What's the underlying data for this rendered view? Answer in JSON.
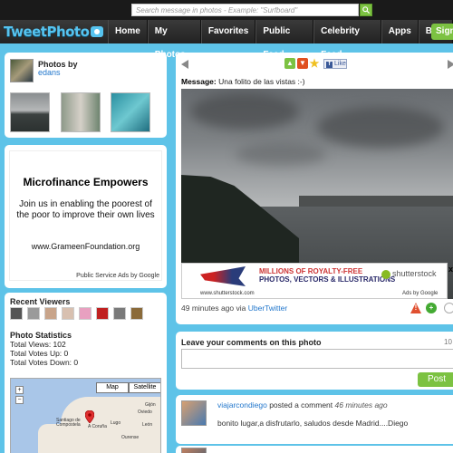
{
  "search": {
    "placeholder": "Search message in photos - Example: \"Surfboard\""
  },
  "header": {
    "logo": "TweetPhoto",
    "nav": [
      "Home",
      "My Photos",
      "Favorites",
      "Public Feed",
      "Celebrity Feed",
      "Apps",
      "Blog"
    ],
    "signup": "Sign"
  },
  "profile": {
    "photos_by_label": "Photos by",
    "username": "edans"
  },
  "ad": {
    "title": "Microfinance Empowers",
    "body": "Join us in enabling the poorest of the poor to improve their own lives",
    "url": "www.GrameenFoundation.org",
    "footer": "Public Service Ads by Google"
  },
  "stats": {
    "recent_viewers_label": "Recent Viewers",
    "photo_statistics_label": "Photo Statistics",
    "total_views": "Total Views: 102",
    "total_votes_up": "Total Votes Up: 0",
    "total_votes_down": "Total Votes Down: 0"
  },
  "map": {
    "map_btn": "Map",
    "satellite_btn": "Satellite",
    "zoom_in": "+",
    "zoom_out": "−",
    "labels": [
      "Santiago de Compostela",
      "A Coruña",
      "Ourense",
      "Lugo",
      "León",
      "Oviedo",
      "Gijón"
    ]
  },
  "photo": {
    "message_label": "Message:",
    "message_text": "Una folito de las vistas :-)",
    "fb_like": "Like",
    "time": "49 minutes ago via",
    "via_app": "UberTwitter"
  },
  "banner": {
    "line1": "MILLIONS OF ROYALTY-FREE",
    "line2": "PHOTOS, VECTORS & ILLUSTRATIONS",
    "brand": "shutterstock",
    "url": "www.shutterstock.com",
    "adsby": "Ads by Google",
    "close": "x"
  },
  "comments": {
    "label": "Leave your comments on this photo",
    "count": "10",
    "post": "Post"
  },
  "thread": [
    {
      "user": "viajarcondiego",
      "action": "posted a comment",
      "time": "46 minutes ago",
      "text": "bonito lugar,a disfrutarlo, saludos desde Madrid....Diego"
    }
  ],
  "colors": {
    "accent": "#5ec3e8",
    "green": "#7cc242",
    "link": "#2277cc"
  }
}
